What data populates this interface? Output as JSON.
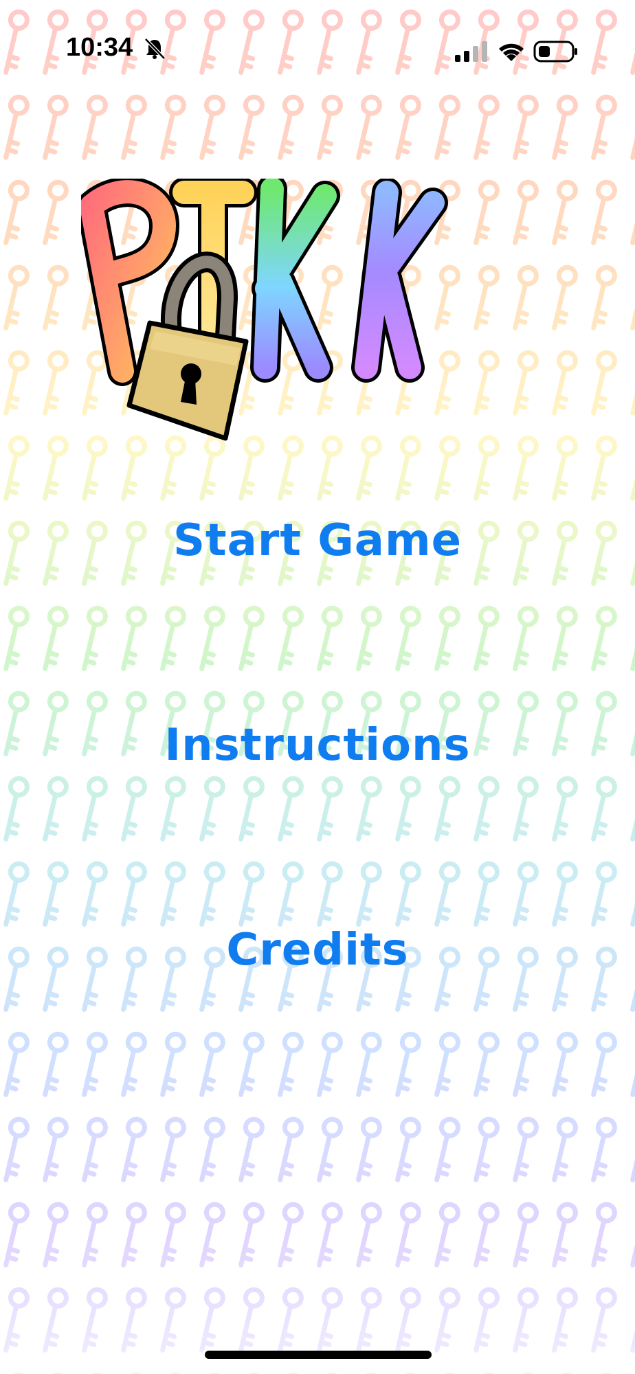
{
  "status_bar": {
    "time": "10:34",
    "icons": [
      "bell-slash-icon",
      "cellular-signal-icon",
      "wifi-icon",
      "battery-icon"
    ]
  },
  "logo": {
    "text": "PIKK",
    "letter_colors": [
      "#ff7a7a",
      "#ffd966",
      "#7be87b",
      "#9b7bff"
    ],
    "lock_color": "#e3c77a"
  },
  "menu": {
    "start": "Start Game",
    "instructions": "Instructions",
    "credits": "Credits"
  },
  "colors": {
    "accent": "#0f7cf0",
    "background": "#ffffff"
  }
}
